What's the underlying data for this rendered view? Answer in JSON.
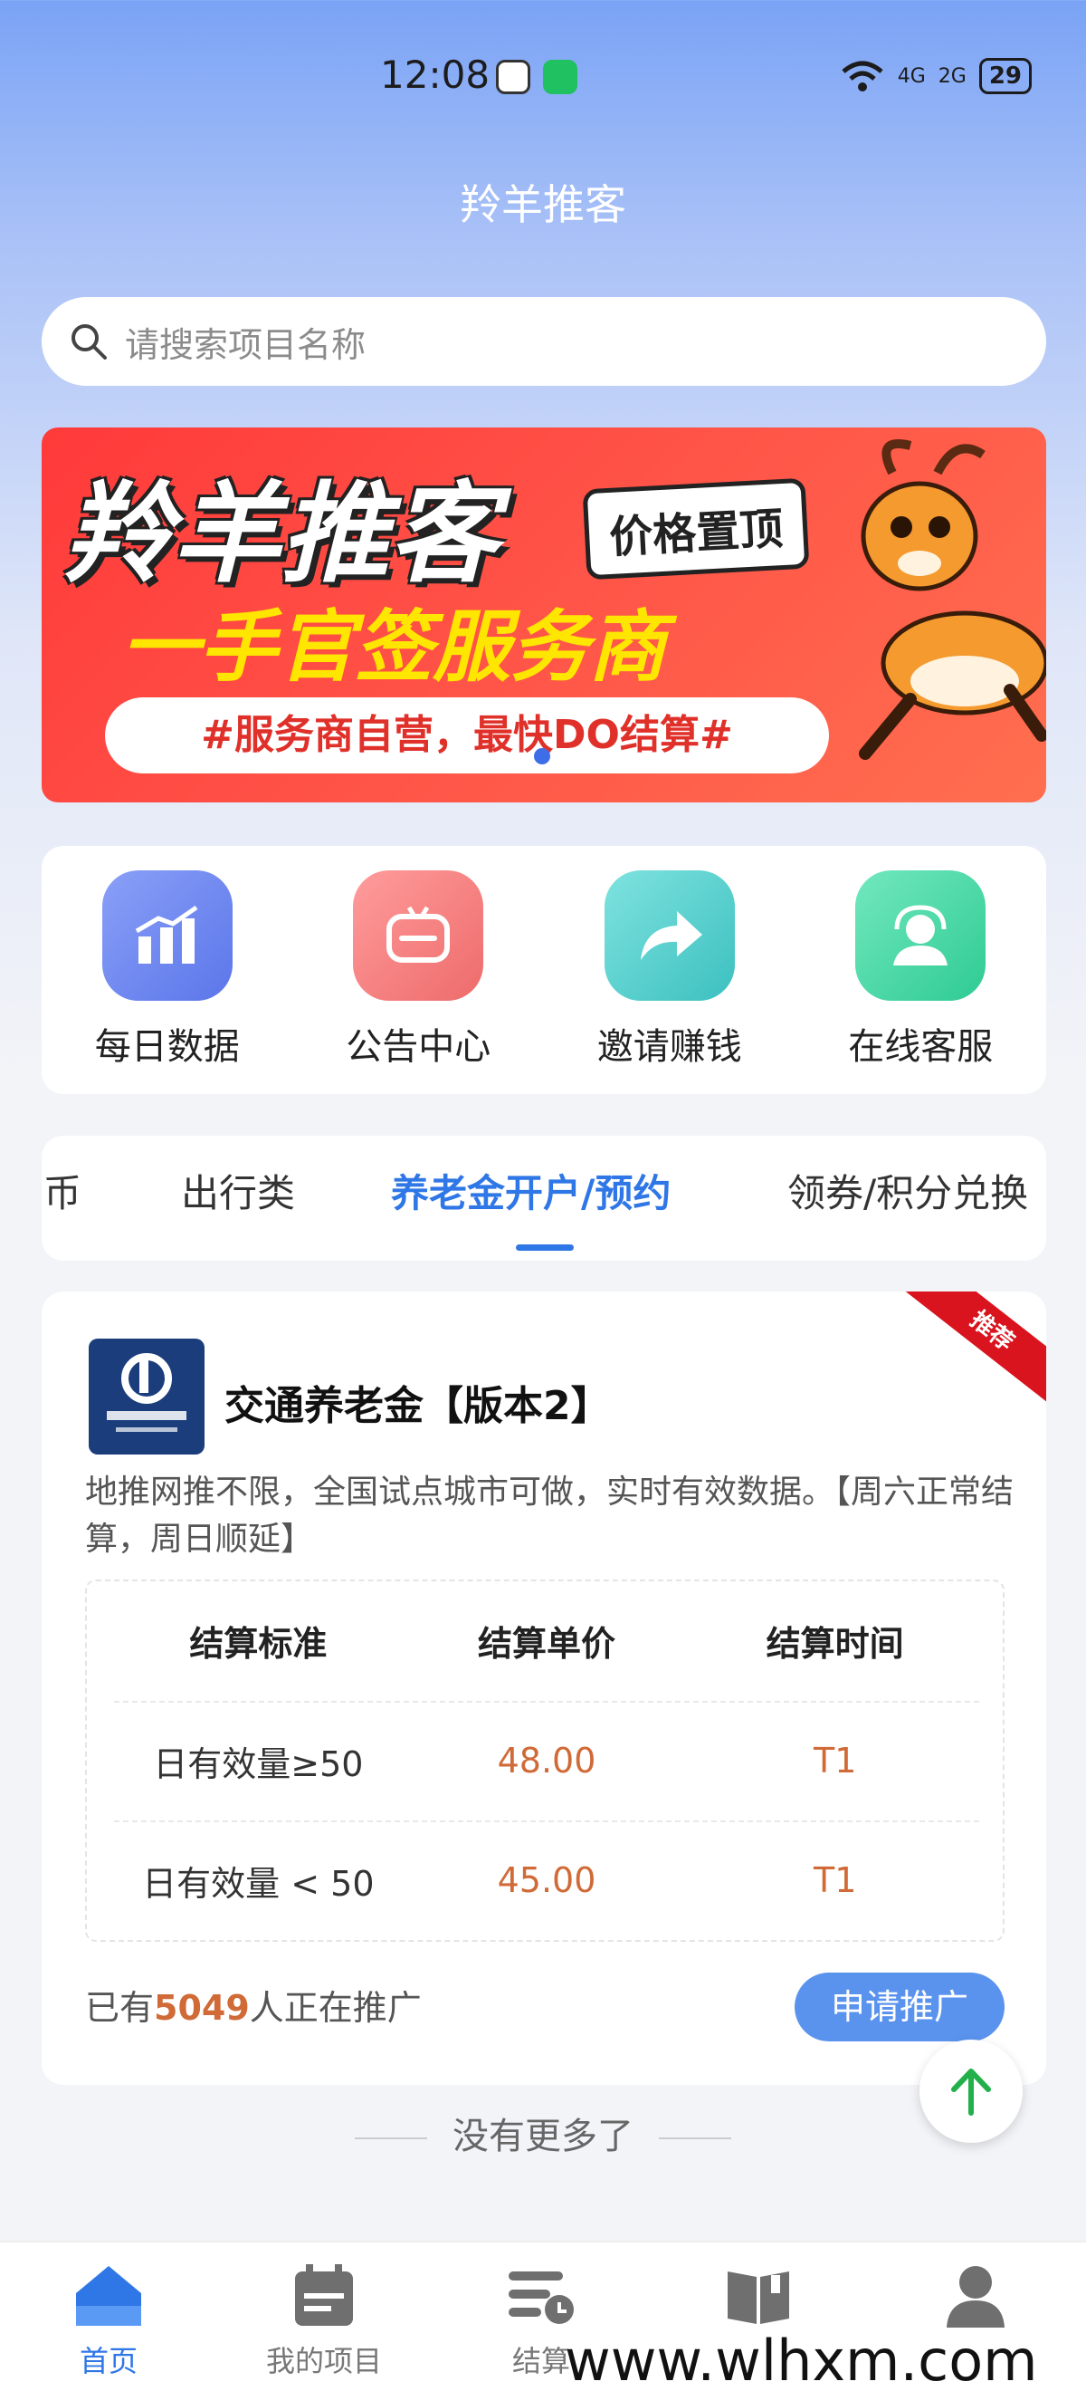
{
  "status_bar": {
    "time": "12:08",
    "network1": "4G",
    "network2": "2G",
    "battery": "29"
  },
  "header": {
    "title": "羚羊推客"
  },
  "search": {
    "placeholder": "请搜索项目名称"
  },
  "banner": {
    "title": "羚羊推客",
    "badge": "价格置顶",
    "subtitle": "一手官签服务商",
    "tagline": "#服务商自营，最快DO结算#"
  },
  "menu": {
    "items": [
      {
        "label": "每日数据",
        "icon": "bar-chart-icon",
        "color": "#6b86f0"
      },
      {
        "label": "公告中心",
        "icon": "message-icon",
        "color": "#f27d7d"
      },
      {
        "label": "邀请赚钱",
        "icon": "share-icon",
        "color": "#4fd0cc"
      },
      {
        "label": "在线客服",
        "icon": "support-icon",
        "color": "#3ed6a3"
      }
    ]
  },
  "tabs": {
    "items": [
      {
        "label": "宝币"
      },
      {
        "label": "出行类"
      },
      {
        "label": "养老金开户/预约"
      },
      {
        "label": "领券/积分兑换"
      }
    ],
    "active_index": 2
  },
  "card": {
    "ribbon": "推荐",
    "title": "交通养老金【版本2】",
    "description": "地推网推不限，全国试点城市可做，实时有效数据。【周六正常结算，周日顺延】",
    "table": {
      "headers": [
        "结算标准",
        "结算单价",
        "结算时间"
      ],
      "rows": [
        [
          "日有效量≥50",
          "48.00",
          "T1"
        ],
        [
          "日有效量 < 50",
          "45.00",
          "T1"
        ]
      ]
    },
    "footer_prefix": "已有",
    "footer_count": "5049",
    "footer_suffix": "人正在推广",
    "apply_label": "申请推广"
  },
  "list_end": {
    "label": "没有更多了"
  },
  "tabbar": {
    "items": [
      {
        "label": "首页",
        "icon": "home-icon",
        "active": true
      },
      {
        "label": "我的项目",
        "icon": "calendar-icon",
        "active": false
      },
      {
        "label": "结算",
        "icon": "settlement-icon",
        "active": false
      },
      {
        "label": "",
        "icon": "book-icon",
        "active": false
      },
      {
        "label": "",
        "icon": "user-icon",
        "active": false
      }
    ]
  },
  "watermark": "www.wlhxm.com",
  "colors": {
    "accent": "#2f77e6",
    "price": "#d06a37"
  }
}
